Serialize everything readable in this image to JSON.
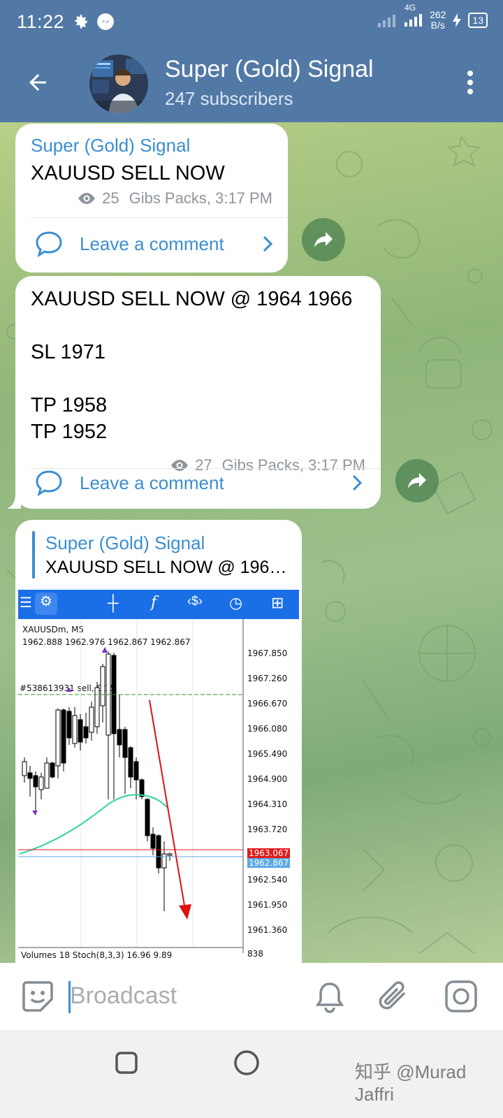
{
  "status_bar": {
    "time": "11:22",
    "network": "4G",
    "speed_value": "262",
    "speed_unit": "B/s",
    "battery": "13"
  },
  "header": {
    "title": "Super (Gold) Signal",
    "subtitle": "247 subscribers"
  },
  "messages": [
    {
      "sender": "Super (Gold) Signal",
      "text": "XAUUSD SELL NOW",
      "views": "25",
      "author_time": "Gibs Packs, 3:17 PM",
      "comment_label": "Leave a comment"
    },
    {
      "text": "XAUUSD SELL NOW @ 1964 1966\n\nSL 1971\n\nTP 1958\nTP 1952",
      "views": "27",
      "author_time": "Gibs Packs, 3:17 PM",
      "comment_label": "Leave a comment"
    },
    {
      "reply_sender": "Super (Gold) Signal",
      "reply_text": "XAUUSD SELL NOW @ 196…",
      "chart": {
        "symbol": "XAUUSDm, M5",
        "ohlc": "1962.888 1962.976 1962.867 1962.867",
        "order_label": "#538613931 sell, 0.25",
        "prices": [
          "1967.850",
          "1967.260",
          "1966.670",
          "1966.080",
          "1965.490",
          "1964.900",
          "1964.310",
          "1963.720",
          "1963.067",
          "1962.867",
          "1962.540",
          "1961.950",
          "1961.360"
        ],
        "indicator": "Volumes 18 Stoch(8,3,3) 16.96 9.89",
        "indicator_value": "838",
        "colors": {
          "toolbar": "#1b6fe6",
          "ask_line": "#e11b1b",
          "bid_line": "#5aa9e6",
          "ma": "#34d39a",
          "arrow": "#e01010"
        }
      }
    }
  ],
  "input": {
    "placeholder": "Broadcast"
  },
  "watermark": "知乎 @Murad Jaffri",
  "colors": {
    "header": "#5279a6",
    "link": "#3b8ed1"
  }
}
